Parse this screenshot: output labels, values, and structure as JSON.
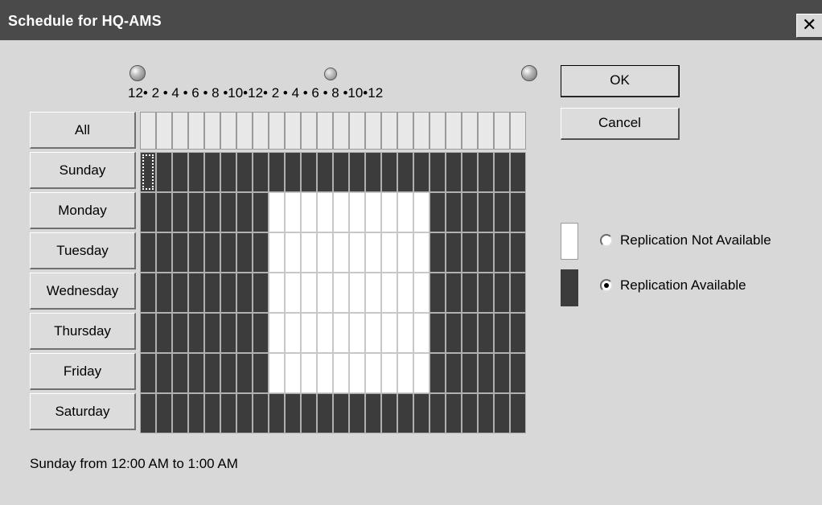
{
  "window": {
    "title": "Schedule for HQ-AMS",
    "close_glyph": "✕"
  },
  "hour_labels": "12• 2 • 4 • 6 • 8 •10•12• 2 • 4 • 6 • 8 •10•12",
  "days": [
    {
      "label": "All"
    },
    {
      "label": "Sunday"
    },
    {
      "label": "Monday"
    },
    {
      "label": "Tuesday"
    },
    {
      "label": "Wednesday"
    },
    {
      "label": "Thursday"
    },
    {
      "label": "Friday"
    },
    {
      "label": "Saturday"
    }
  ],
  "schedule": {
    "hours_per_day": 24,
    "available_hours": {
      "Sunday": "0-23",
      "Monday": "0-7,18-23",
      "Tuesday": "0-7,18-23",
      "Wednesday": "0-7,18-23",
      "Thursday": "0-7,18-23",
      "Friday": "0-7,18-23",
      "Saturday": "0-23"
    },
    "selected_cell": {
      "day": "Sunday",
      "hour": 0
    }
  },
  "buttons": {
    "ok": "OK",
    "cancel": "Cancel"
  },
  "legend": {
    "not_available": "Replication Not Available",
    "available": "Replication Available",
    "selected": "available"
  },
  "colors": {
    "available": "#3c3c3c",
    "not_available": "#ffffff",
    "titlebar": "#4a4a4a"
  },
  "status": "Sunday from 12:00 AM to 1:00 AM"
}
